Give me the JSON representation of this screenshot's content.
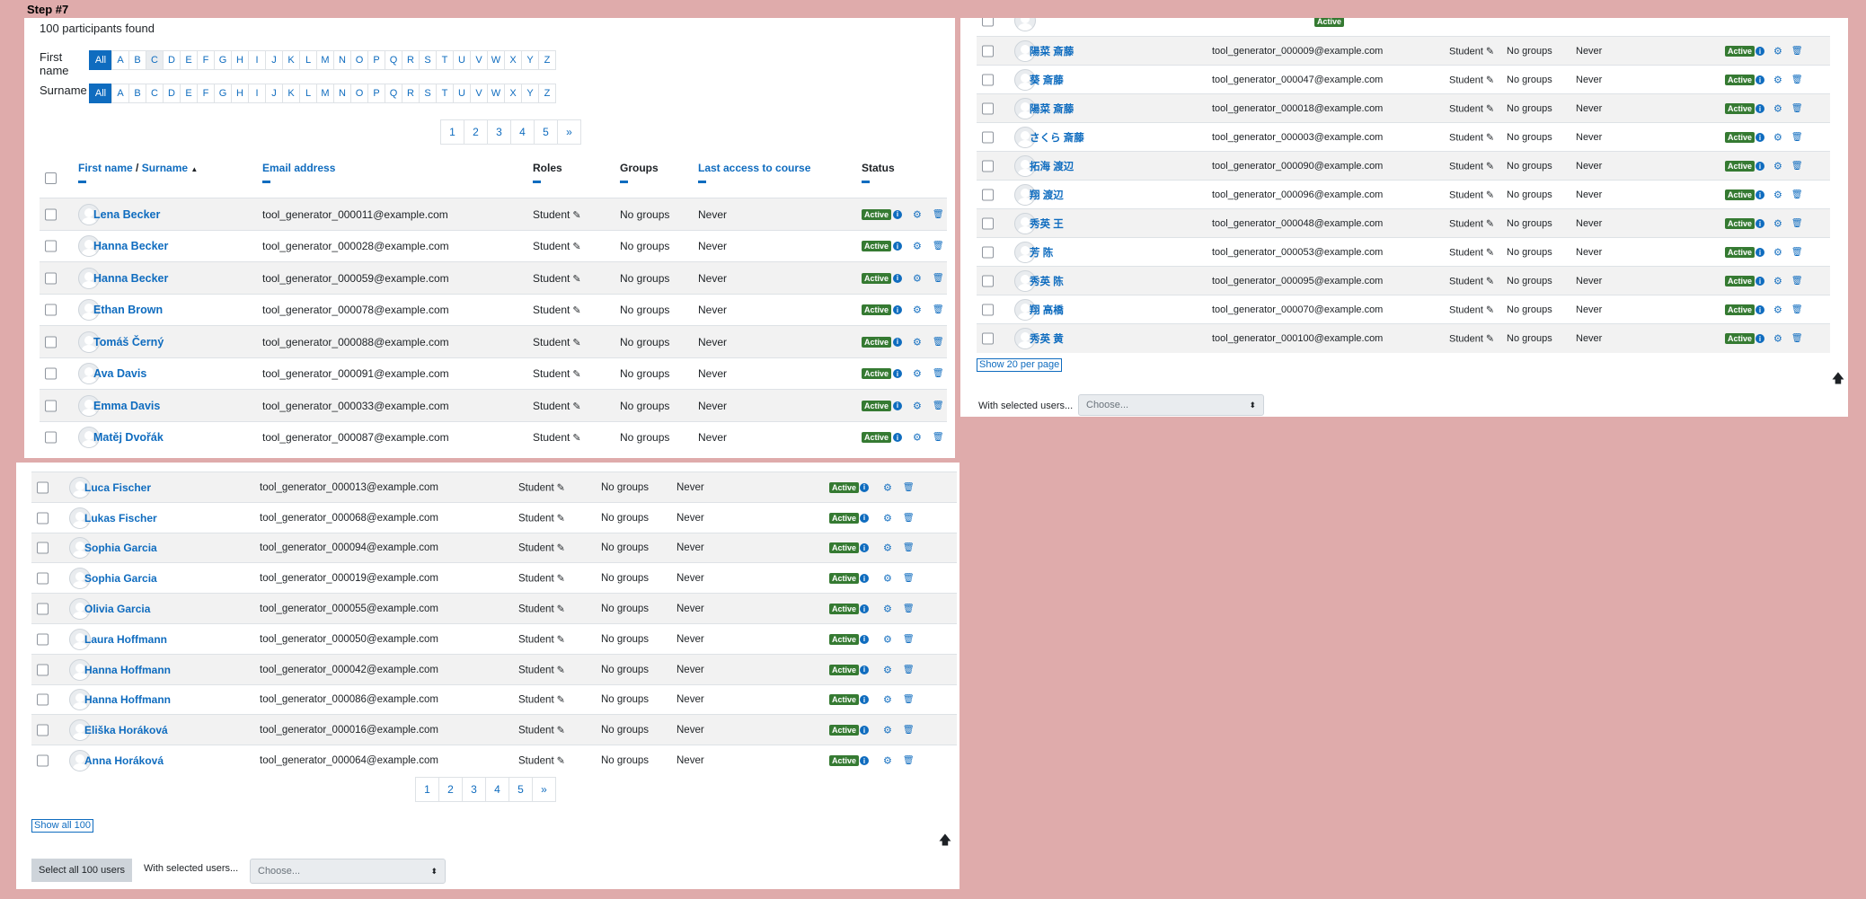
{
  "step_label": "Step #7",
  "participants_found": "100 participants found",
  "initials": {
    "first_label": "First name",
    "surname_label": "Surname",
    "all": "All",
    "letters": [
      "A",
      "B",
      "C",
      "D",
      "E",
      "F",
      "G",
      "H",
      "I",
      "J",
      "K",
      "L",
      "M",
      "N",
      "O",
      "P",
      "Q",
      "R",
      "S",
      "T",
      "U",
      "V",
      "W",
      "X",
      "Y",
      "Z"
    ]
  },
  "pagination": [
    "1",
    "2",
    "3",
    "4",
    "5",
    "»"
  ],
  "columns": {
    "first_name": "First name",
    "slash": " / ",
    "surname": "Surname",
    "sort_arrow": "▲",
    "email": "Email address",
    "roles": "Roles",
    "groups": "Groups",
    "last_access": "Last access to course",
    "status": "Status"
  },
  "row_defaults": {
    "role": "Student",
    "groups": "No groups",
    "last_access": "Never",
    "status": "Active"
  },
  "icons": {
    "pencil": "✎",
    "info": "i",
    "cog": "⚙",
    "trash": "🗑",
    "up": "🡅",
    "caret": "⬍"
  },
  "rows_top": [
    {
      "name": "Lena Becker",
      "email": "tool_generator_000011@example.com"
    },
    {
      "name": "Hanna Becker",
      "email": "tool_generator_000028@example.com"
    },
    {
      "name": "Hanna Becker",
      "email": "tool_generator_000059@example.com"
    },
    {
      "name": "Ethan Brown",
      "email": "tool_generator_000078@example.com"
    },
    {
      "name": "Tomáš Černý",
      "email": "tool_generator_000088@example.com"
    },
    {
      "name": "Ava Davis",
      "email": "tool_generator_000091@example.com"
    },
    {
      "name": "Emma Davis",
      "email": "tool_generator_000033@example.com"
    },
    {
      "name": "Matěj Dvořák",
      "email": "tool_generator_000087@example.com"
    }
  ],
  "rows_right": [
    {
      "name": "陽菜 斎藤",
      "email": "tool_generator_000009@example.com"
    },
    {
      "name": "葵 斎藤",
      "email": "tool_generator_000047@example.com"
    },
    {
      "name": "陽菜 斎藤",
      "email": "tool_generator_000018@example.com"
    },
    {
      "name": "さくら 斎藤",
      "email": "tool_generator_000003@example.com"
    },
    {
      "name": "拓海 渡辺",
      "email": "tool_generator_000090@example.com"
    },
    {
      "name": "翔 渡辺",
      "email": "tool_generator_000096@example.com"
    },
    {
      "name": "秀英 王",
      "email": "tool_generator_000048@example.com"
    },
    {
      "name": "芳 陈",
      "email": "tool_generator_000053@example.com"
    },
    {
      "name": "秀英 陈",
      "email": "tool_generator_000095@example.com"
    },
    {
      "name": "翔 高橋",
      "email": "tool_generator_000070@example.com"
    },
    {
      "name": "秀英 黄",
      "email": "tool_generator_000100@example.com"
    }
  ],
  "rows_bottom": [
    {
      "name": "Luca Fischer",
      "email": "tool_generator_000013@example.com"
    },
    {
      "name": "Lukas Fischer",
      "email": "tool_generator_000068@example.com"
    },
    {
      "name": "Sophia Garcia",
      "email": "tool_generator_000094@example.com"
    },
    {
      "name": "Sophia Garcia",
      "email": "tool_generator_000019@example.com"
    },
    {
      "name": "Olivia Garcia",
      "email": "tool_generator_000055@example.com"
    },
    {
      "name": "Laura Hoffmann",
      "email": "tool_generator_000050@example.com"
    },
    {
      "name": "Hanna Hoffmann",
      "email": "tool_generator_000042@example.com"
    },
    {
      "name": "Hanna Hoffmann",
      "email": "tool_generator_000086@example.com"
    },
    {
      "name": "Eliška Horáková",
      "email": "tool_generator_000016@example.com"
    },
    {
      "name": "Anna Horáková",
      "email": "tool_generator_000064@example.com"
    }
  ],
  "show_20": "Show 20 per page",
  "show_all": "Show all 100",
  "select_all": "Select all 100 users",
  "with_selected": "With selected users...",
  "choose": "Choose..."
}
